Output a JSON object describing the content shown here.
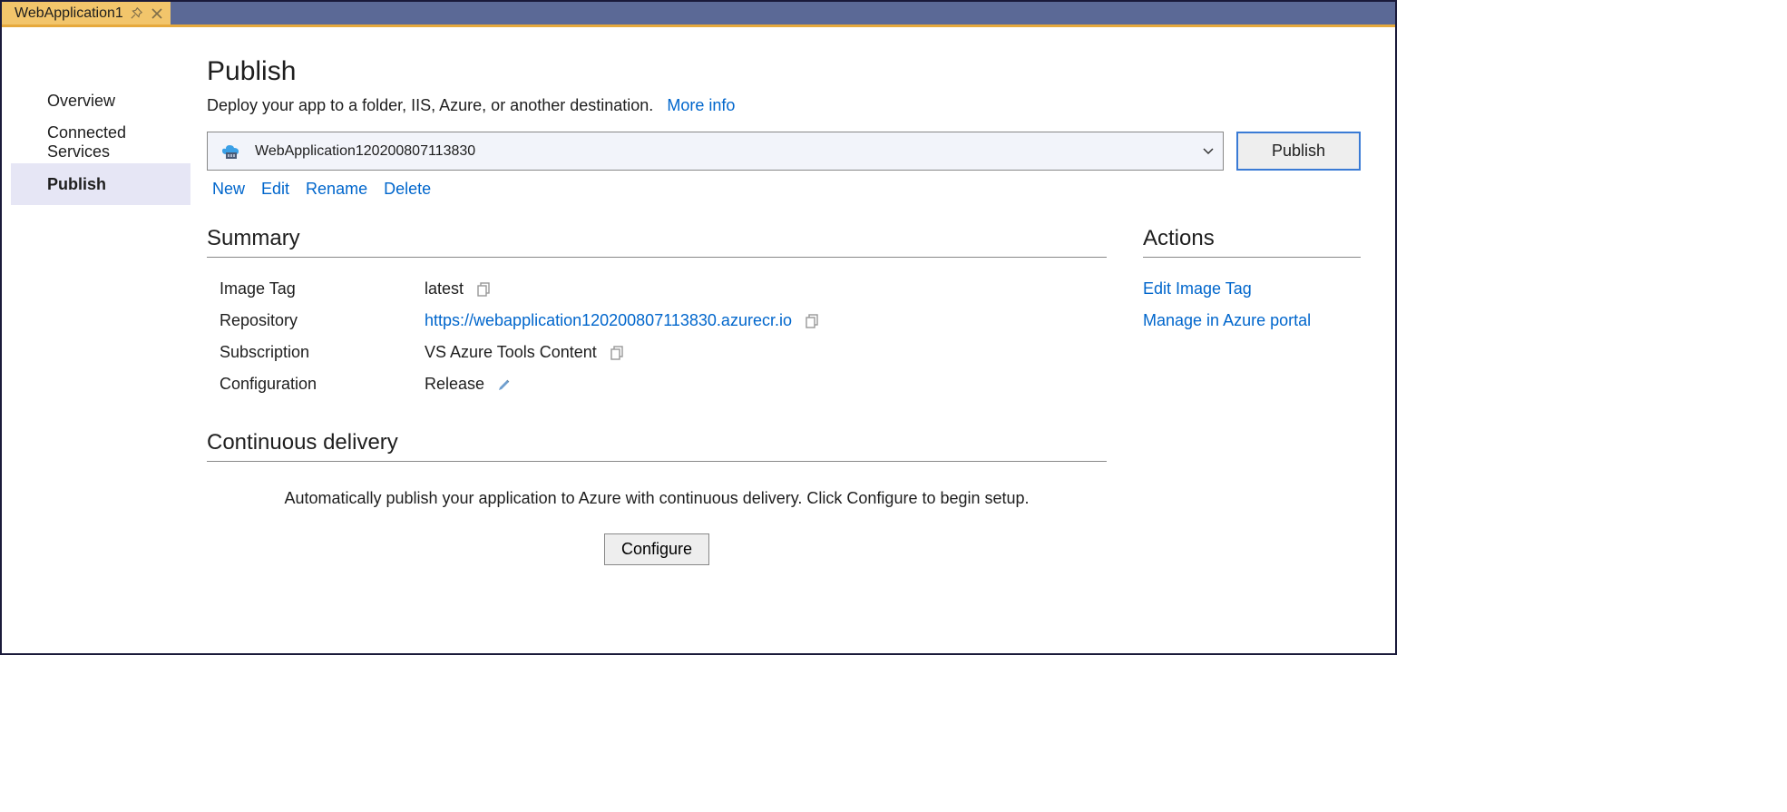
{
  "tab": {
    "title": "WebApplication1"
  },
  "sidebar": {
    "items": [
      {
        "label": "Overview"
      },
      {
        "label": "Connected Services"
      },
      {
        "label": "Publish"
      }
    ],
    "active_index": 2
  },
  "page": {
    "title": "Publish",
    "subtitle": "Deploy your app to a folder, IIS, Azure, or another destination.",
    "more_info": "More info"
  },
  "profile": {
    "selected": "WebApplication120200807113830",
    "publish_button": "Publish",
    "actions": [
      "New",
      "Edit",
      "Rename",
      "Delete"
    ]
  },
  "summary": {
    "title": "Summary",
    "rows": {
      "image_tag": {
        "key": "Image Tag",
        "value": "latest"
      },
      "repository": {
        "key": "Repository",
        "value": "https://webapplication120200807113830.azurecr.io"
      },
      "subscription": {
        "key": "Subscription",
        "value": "VS Azure Tools Content"
      },
      "configuration": {
        "key": "Configuration",
        "value": "Release"
      }
    }
  },
  "actions_panel": {
    "title": "Actions",
    "items": [
      "Edit Image Tag",
      "Manage in Azure portal"
    ]
  },
  "continuous_delivery": {
    "title": "Continuous delivery",
    "description": "Automatically publish your application to Azure with continuous delivery. Click Configure to begin setup.",
    "button": "Configure"
  }
}
